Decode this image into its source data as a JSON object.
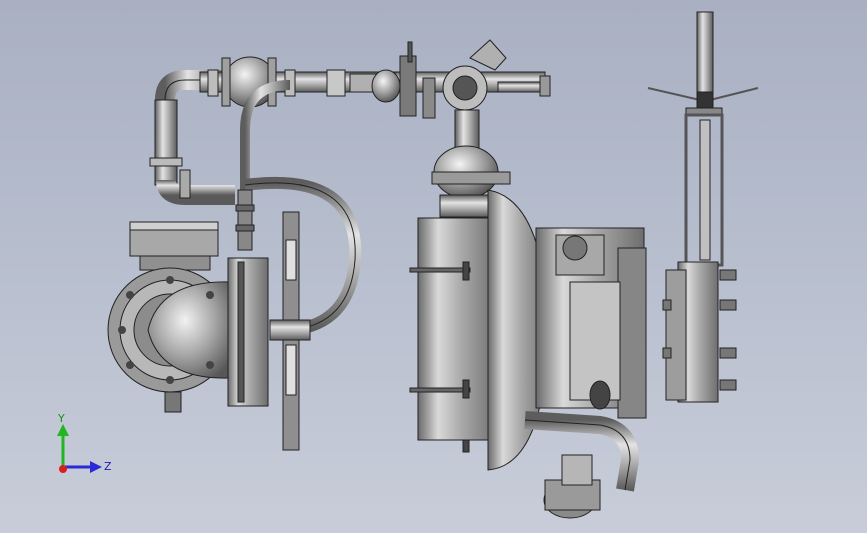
{
  "viewport": {
    "background_top": "#a9b0c2",
    "background_bottom": "#c8cdd9"
  },
  "triad": {
    "y_label": "Y",
    "z_label": "Z",
    "y_color": "#21b521",
    "z_color": "#2a2ad8",
    "x_color": "#d62020"
  },
  "model": {
    "metal_color": "#9b9b9b",
    "edge_color": "#222222"
  }
}
